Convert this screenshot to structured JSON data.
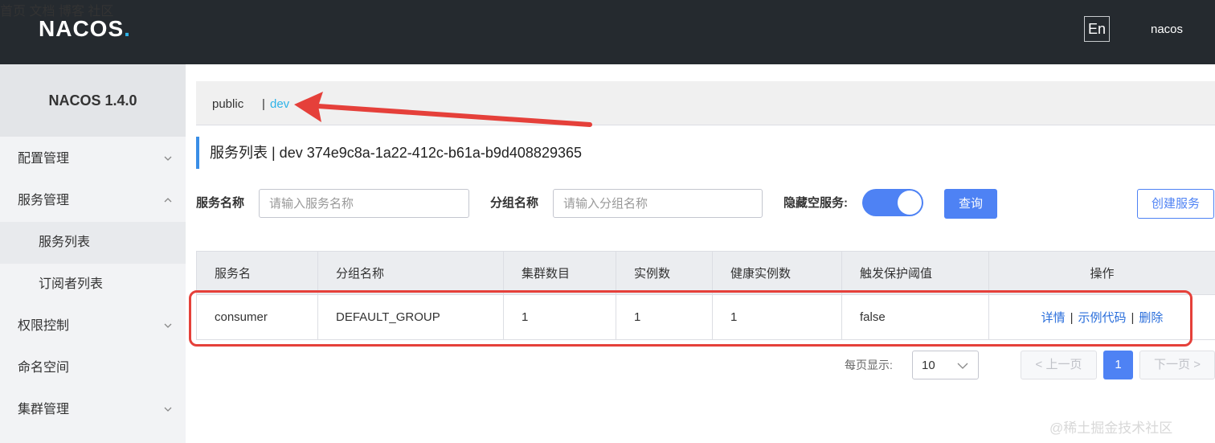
{
  "header": {
    "logo": "NAC",
    "logo_os": "OS",
    "logo_dot": ".",
    "nav": [
      "首页",
      "文档",
      "博客",
      "社区"
    ],
    "lang": "En",
    "user": "nacos"
  },
  "sidebar": {
    "title": "NACOS 1.4.0",
    "items": [
      {
        "label": "配置管理",
        "chevron": "down"
      },
      {
        "label": "服务管理",
        "chevron": "up"
      },
      {
        "label": "服务列表",
        "sub": true
      },
      {
        "label": "订阅者列表",
        "sub": true
      },
      {
        "label": "权限控制",
        "chevron": "down"
      },
      {
        "label": "命名空间"
      },
      {
        "label": "集群管理",
        "chevron": "down"
      }
    ]
  },
  "namespace": {
    "public": "public",
    "separator": "|",
    "dev": "dev"
  },
  "page": {
    "title": "服务列表  |  dev  374e9c8a-1a22-412c-b61a-b9d408829365"
  },
  "filters": {
    "service_name_label": "服务名称",
    "service_name_placeholder": "请输入服务名称",
    "group_name_label": "分组名称",
    "group_name_placeholder": "请输入分组名称",
    "hide_empty_label": "隐藏空服务:",
    "query_button": "查询",
    "create_button": "创建服务"
  },
  "table": {
    "headers": [
      "服务名",
      "分组名称",
      "集群数目",
      "实例数",
      "健康实例数",
      "触发保护阈值",
      "操作"
    ],
    "rows": [
      {
        "name": "consumer",
        "group": "DEFAULT_GROUP",
        "clusters": "1",
        "instances": "1",
        "healthy": "1",
        "threshold": "false",
        "ops": [
          "详情",
          "示例代码",
          "删除"
        ]
      }
    ],
    "op_separator": "|"
  },
  "pagination": {
    "per_page_label": "每页显示:",
    "page_size": "10",
    "prev": "< 上一页",
    "current": "1",
    "next": "下一页 >"
  },
  "watermark": "@稀土掘金技术社区",
  "colors": {
    "header_bg": "#252a2f",
    "accent": "#4e82f4",
    "link": "#2a6edb",
    "namespace_active": "#2fb3e8",
    "annotation_red": "#e5403a"
  }
}
